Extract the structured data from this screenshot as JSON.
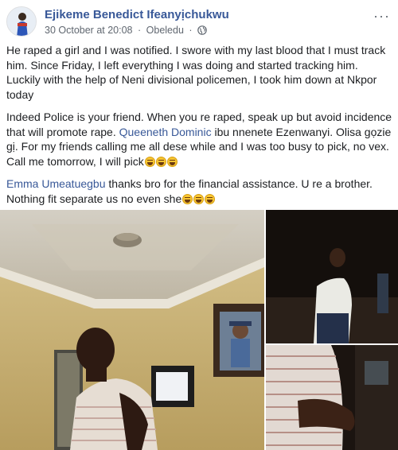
{
  "post": {
    "author": "Ejikeme Benedict Ifeanyịchukwu",
    "date": "30 October at 20:08",
    "separator": "·",
    "location": "Obeledu",
    "privacy_icon": "globe-icon",
    "more_icon": "more-options-icon",
    "more_label": "···",
    "paragraph1": "He raped a girl and I was notified. I swore with my last blood that I must track him. Since Friday, I left everything I was doing and started tracking him. Luckily with the help of Neni divisional policemen, I took him down at Nkpor today",
    "paragraph2_part1": "Indeed Police is your friend. When you re raped, speak up but avoid incidence that will promote rape. ",
    "paragraph2_mention": "Queeneth Dominic",
    "paragraph2_part2": " ibu nnenete Ezenwanyi. Olisa gọzie gị. For my friends calling me all dese while and I was too busy to pick, no vex. Call me tomorrow, I will pick",
    "paragraph3_mention": "Emma Umeatuegbu",
    "paragraph3_text": " thanks bro for the financial assistance. U re a brother. Nothing fit separate us no even she",
    "emoji_icon": "tears-of-joy-emoji-icon",
    "colors": {
      "link": "#385898",
      "text": "#1c1e21",
      "meta": "#606770"
    }
  }
}
